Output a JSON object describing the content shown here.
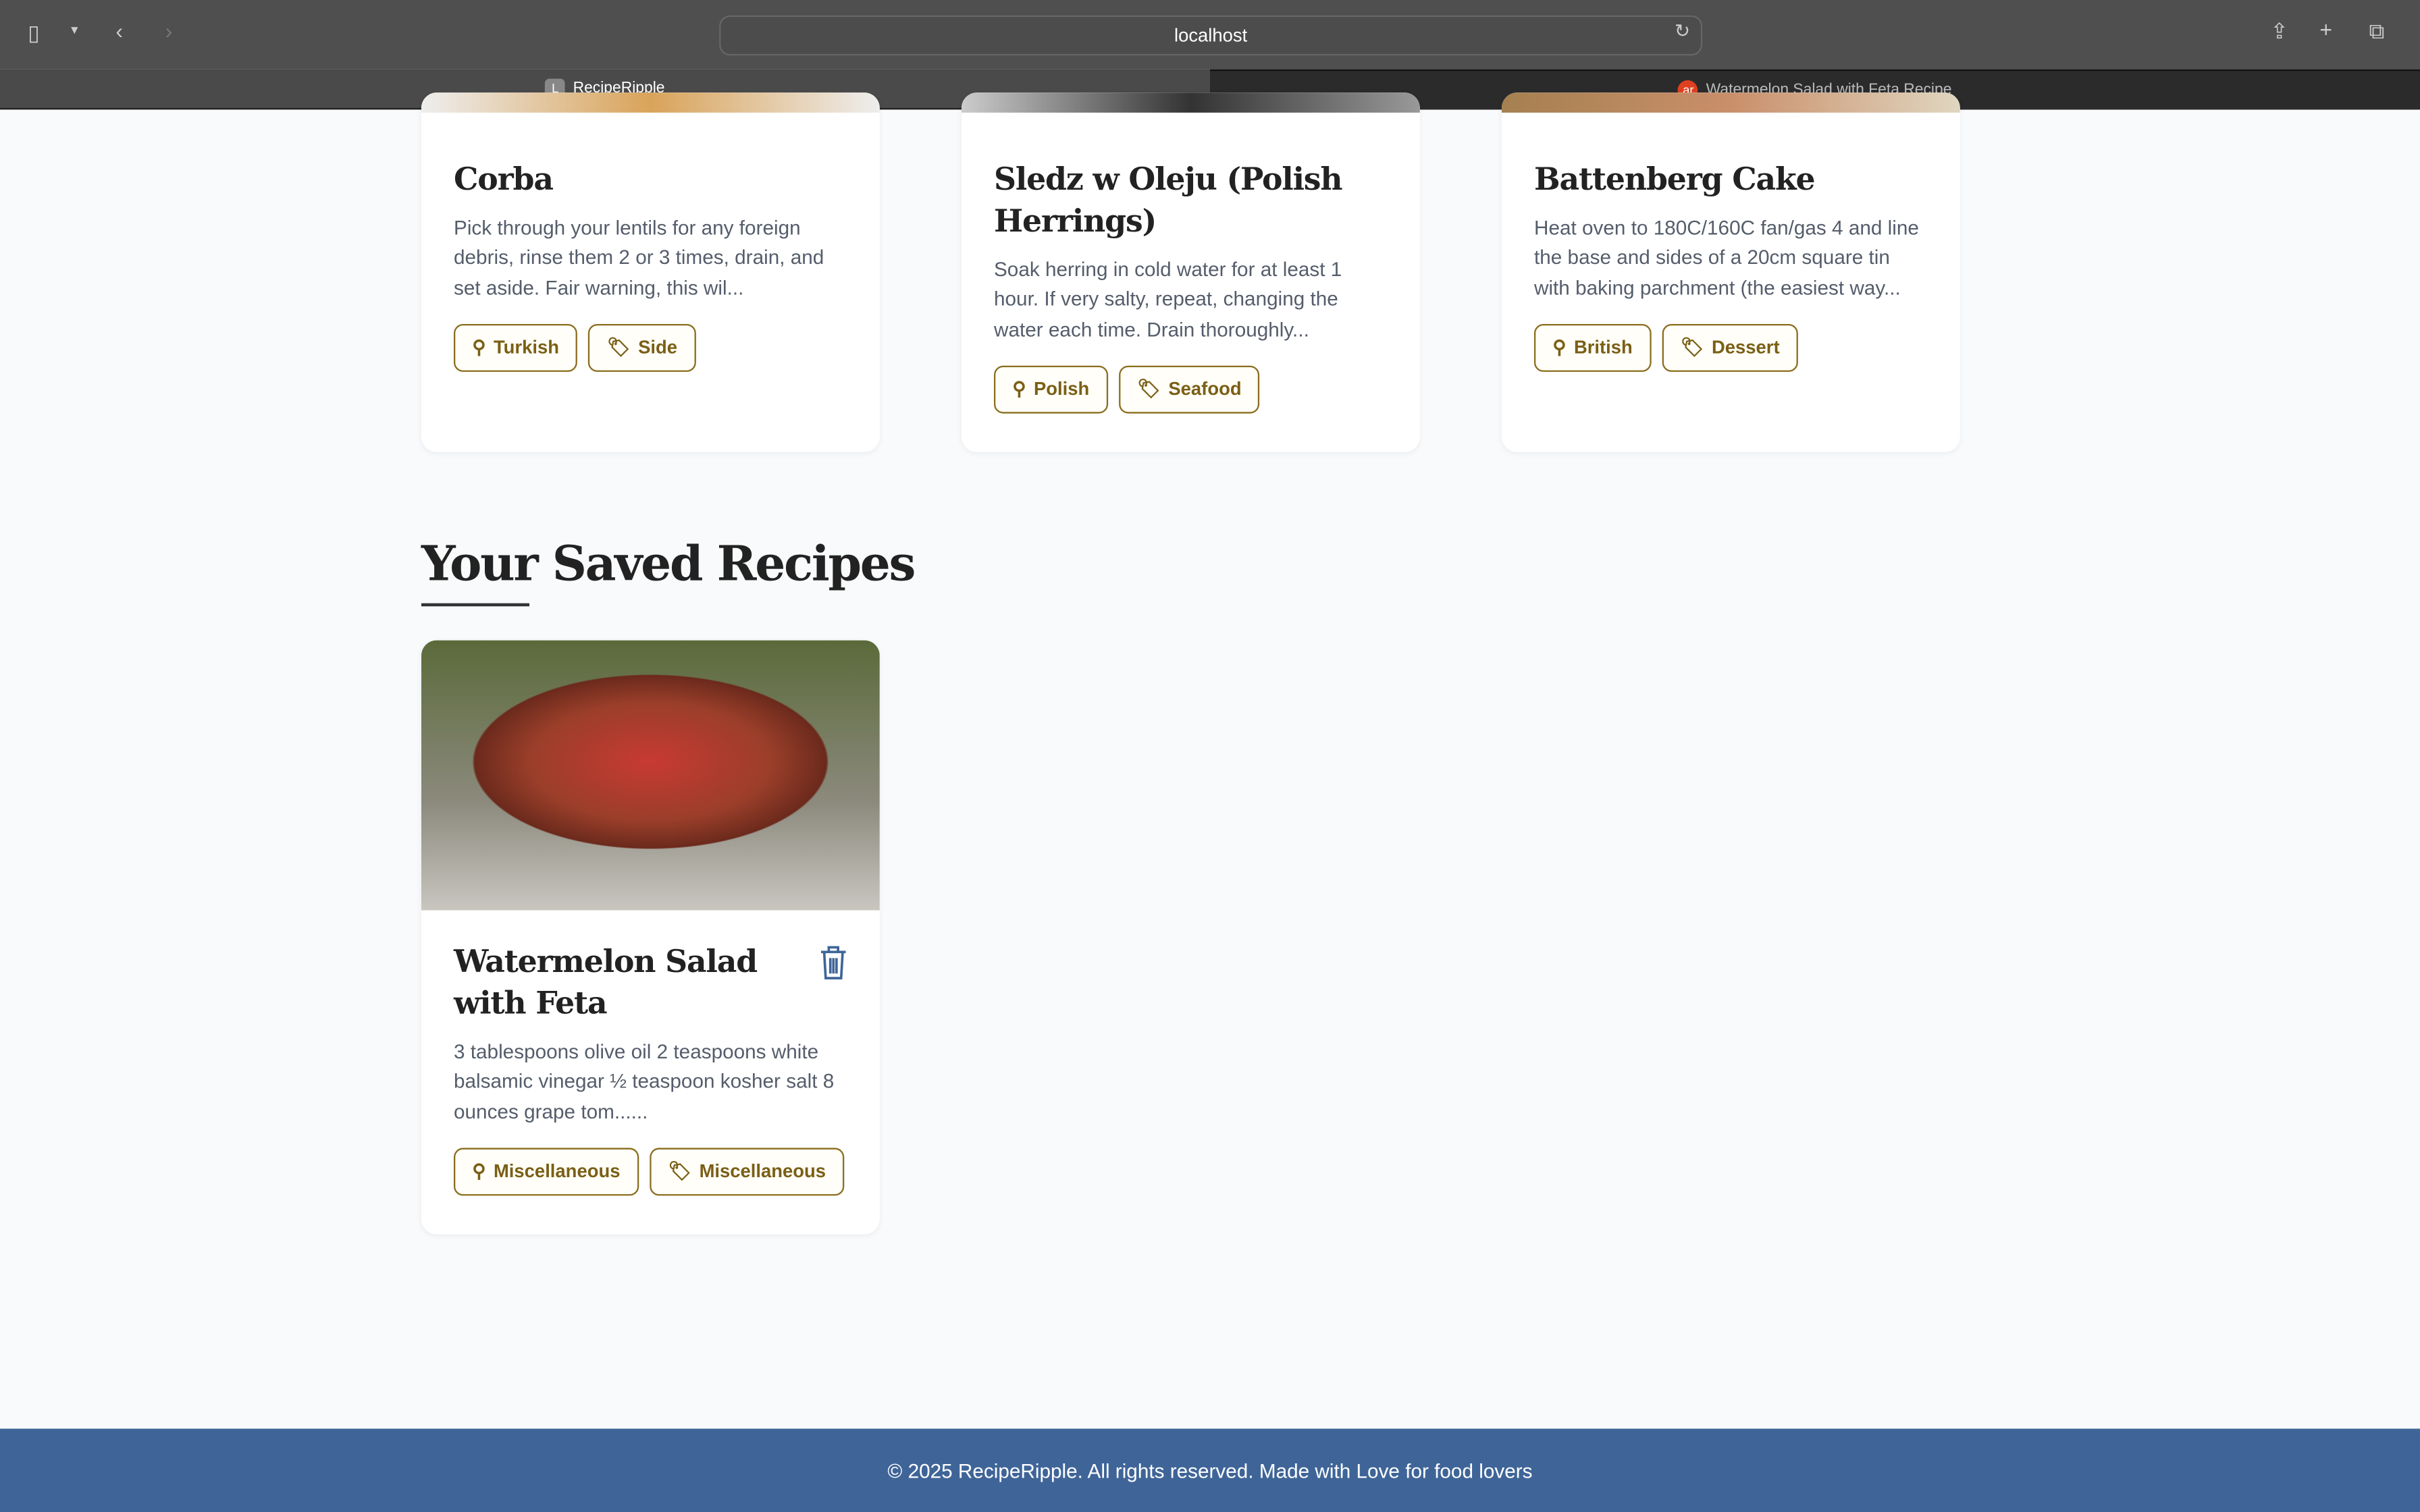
{
  "browser": {
    "url": "localhost",
    "tabs": [
      {
        "label": "RecipeRipple",
        "favicon": "L",
        "active": true
      },
      {
        "label": "Watermelon Salad with Feta Recipe",
        "favicon": "ar",
        "active": false
      }
    ]
  },
  "recipes": [
    {
      "title": "Corba",
      "description": "Pick through your lentils for any foreign debris, rinse them 2 or 3 times, drain, and set aside. Fair warning, this wil...",
      "area": "Turkish",
      "category": "Side"
    },
    {
      "title": "Sledz w Oleju (Polish Herrings)",
      "description": "Soak herring in cold water for at least 1 hour. If very salty, repeat, changing the water each time.  Drain thoroughly...",
      "area": "Polish",
      "category": "Seafood"
    },
    {
      "title": "Battenberg Cake",
      "description": "Heat oven to 180C/160C fan/gas 4 and line the base and sides of a 20cm square tin with baking parchment (the easiest way...",
      "area": "British",
      "category": "Dessert"
    }
  ],
  "saved": {
    "heading": "Your Saved Recipes",
    "items": [
      {
        "title": "Watermelon Salad with Feta",
        "description": "3 tablespoons olive oil 2 teaspoons white balsamic vinegar ½ teaspoon kosher salt 8 ounces grape tom......",
        "area": "Miscellaneous",
        "category": "Miscellaneous"
      }
    ]
  },
  "footer": {
    "text": "© 2025 RecipeRipple. All rights reserved. Made with Love for food lovers"
  },
  "colors": {
    "accent": "#8a6d1e",
    "footer": "#3f6598",
    "delete": "#3f6598"
  }
}
